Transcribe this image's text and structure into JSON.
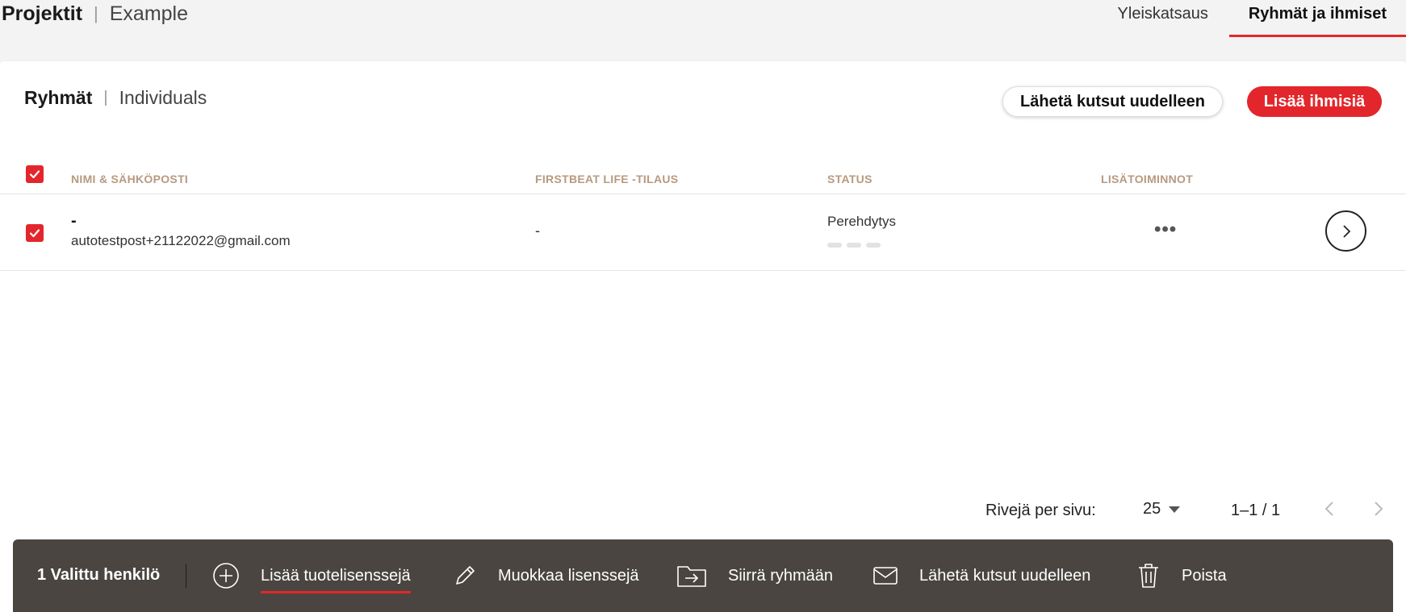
{
  "header": {
    "crumb_main": "Projektit",
    "crumb_sep": "|",
    "crumb_sub": "Example",
    "tabs": [
      {
        "label": "Yleiskatsaus",
        "active": false
      },
      {
        "label": "Ryhmät ja ihmiset",
        "active": true
      }
    ]
  },
  "card": {
    "title_main": "Ryhmät",
    "title_sep": "|",
    "title_sub": "Individuals",
    "resend_label": "Lähetä kutsut uudelleen",
    "add_label": "Lisää ihmisiä"
  },
  "table": {
    "columns": [
      "NIMI & SÄHKÖPOSTI",
      "FIRSTBEAT LIFE -TILAUS",
      "STATUS",
      "LISÄTOIMINNOT"
    ],
    "rows": [
      {
        "name": "-",
        "email": "autotestpost+21122022@gmail.com",
        "subscription": "-",
        "status": "Perehdytys",
        "selected": true
      }
    ]
  },
  "pagination": {
    "rows_label": "Rivejä per sivu:",
    "rows_value": "25",
    "range": "1–1 / 1"
  },
  "actionbar": {
    "selected_count": "1 Valittu henkilö",
    "actions": [
      {
        "label": "Lisää tuotelisenssejä",
        "icon": "plus-circle-icon",
        "active": true
      },
      {
        "label": "Muokkaa lisenssejä",
        "icon": "pencil-icon",
        "active": false
      },
      {
        "label": "Siirrä ryhmään",
        "icon": "folder-move-icon",
        "active": false
      },
      {
        "label": "Lähetä kutsut uudelleen",
        "icon": "envelope-icon",
        "active": false
      },
      {
        "label": "Poista",
        "icon": "trash-icon",
        "active": false
      }
    ]
  },
  "colors": {
    "accent": "#e3262b",
    "header_label": "#b79a7f",
    "actionbar_bg": "#4a4540"
  }
}
